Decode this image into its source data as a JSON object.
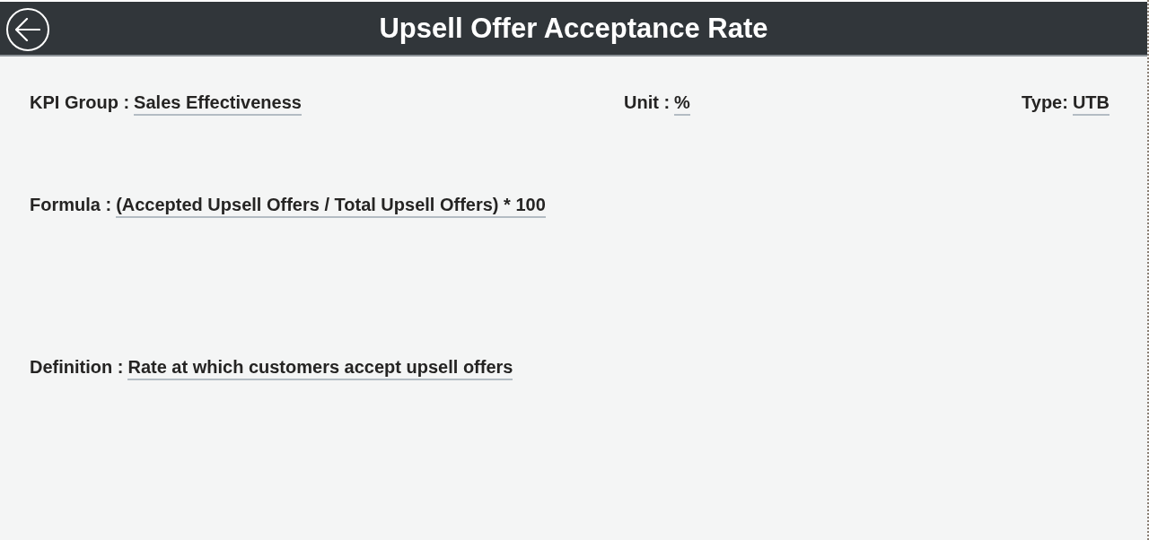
{
  "header": {
    "title": "Upsell Offer Acceptance Rate"
  },
  "rows": [
    {
      "fields": [
        {
          "label": "KPI Group :",
          "value": "Sales Effectiveness"
        },
        {
          "label": "Unit :",
          "value": "%"
        },
        {
          "label": "Type:",
          "value": "UTB"
        }
      ]
    },
    {
      "fields": [
        {
          "label": "Formula :",
          "value": "(Accepted Upsell Offers / Total Upsell Offers) * 100"
        }
      ]
    },
    {
      "fields": [
        {
          "label": "Definition :",
          "value": "Rate at which customers accept upsell offers"
        }
      ]
    }
  ]
}
